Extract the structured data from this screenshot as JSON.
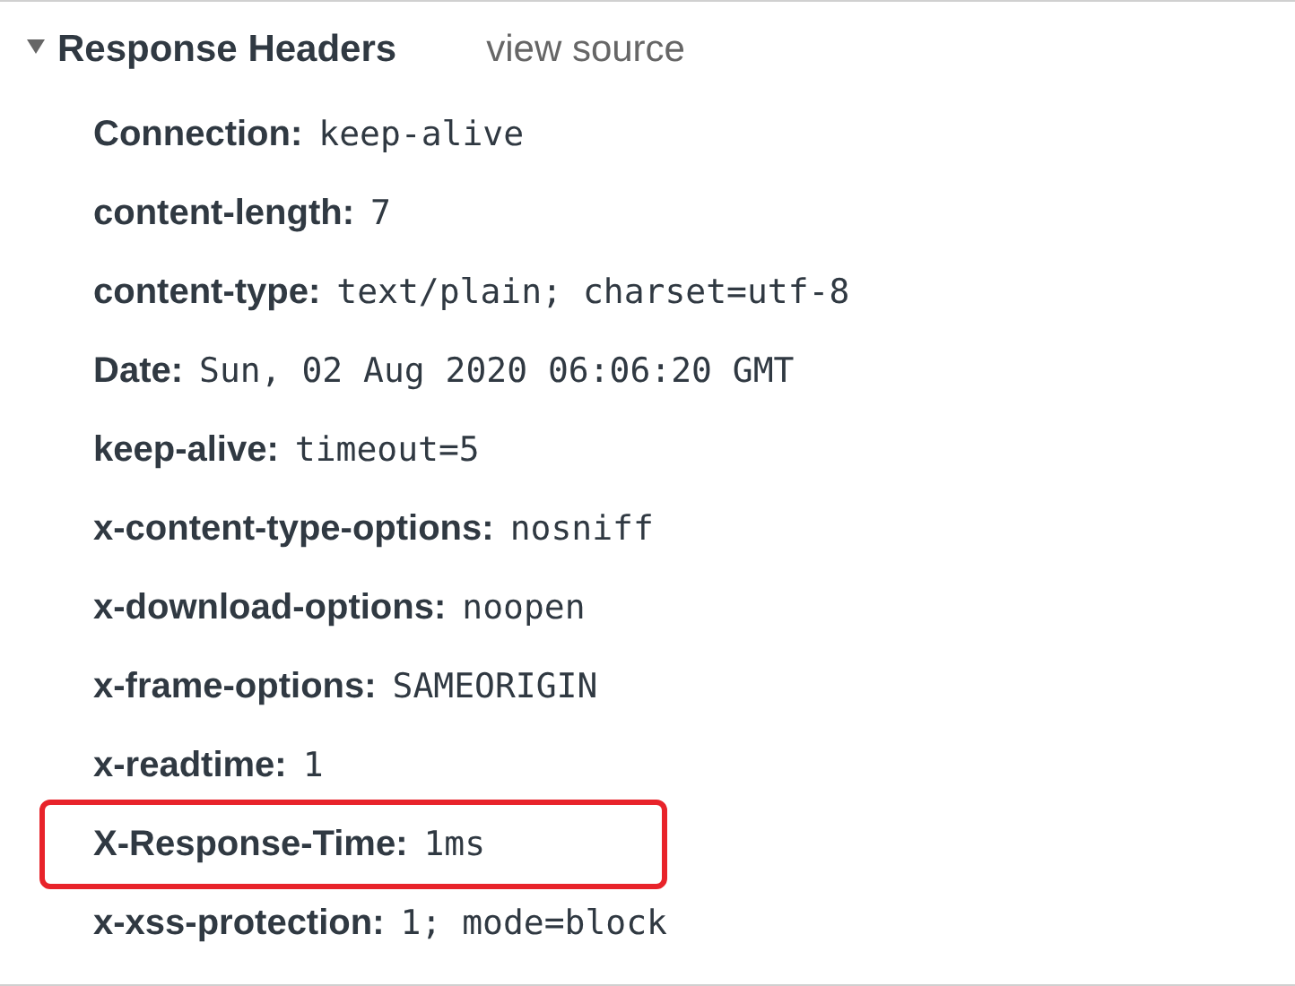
{
  "section": {
    "title": "Response Headers",
    "expanded": true,
    "view_source": "view source"
  },
  "headers": [
    {
      "name": "Connection:",
      "value": "keep-alive",
      "highlighted": false
    },
    {
      "name": "content-length:",
      "value": "7",
      "highlighted": false
    },
    {
      "name": "content-type:",
      "value": "text/plain; charset=utf-8",
      "highlighted": false
    },
    {
      "name": "Date:",
      "value": "Sun, 02 Aug 2020 06:06:20 GMT",
      "highlighted": false
    },
    {
      "name": "keep-alive:",
      "value": "timeout=5",
      "highlighted": false
    },
    {
      "name": "x-content-type-options:",
      "value": "nosniff",
      "highlighted": false
    },
    {
      "name": "x-download-options:",
      "value": "noopen",
      "highlighted": false
    },
    {
      "name": "x-frame-options:",
      "value": "SAMEORIGIN",
      "highlighted": false
    },
    {
      "name": "x-readtime:",
      "value": "1",
      "highlighted": false
    },
    {
      "name": "X-Response-Time:",
      "value": "1ms",
      "highlighted": true
    },
    {
      "name": "x-xss-protection:",
      "value": "1; mode=block",
      "highlighted": false
    }
  ]
}
